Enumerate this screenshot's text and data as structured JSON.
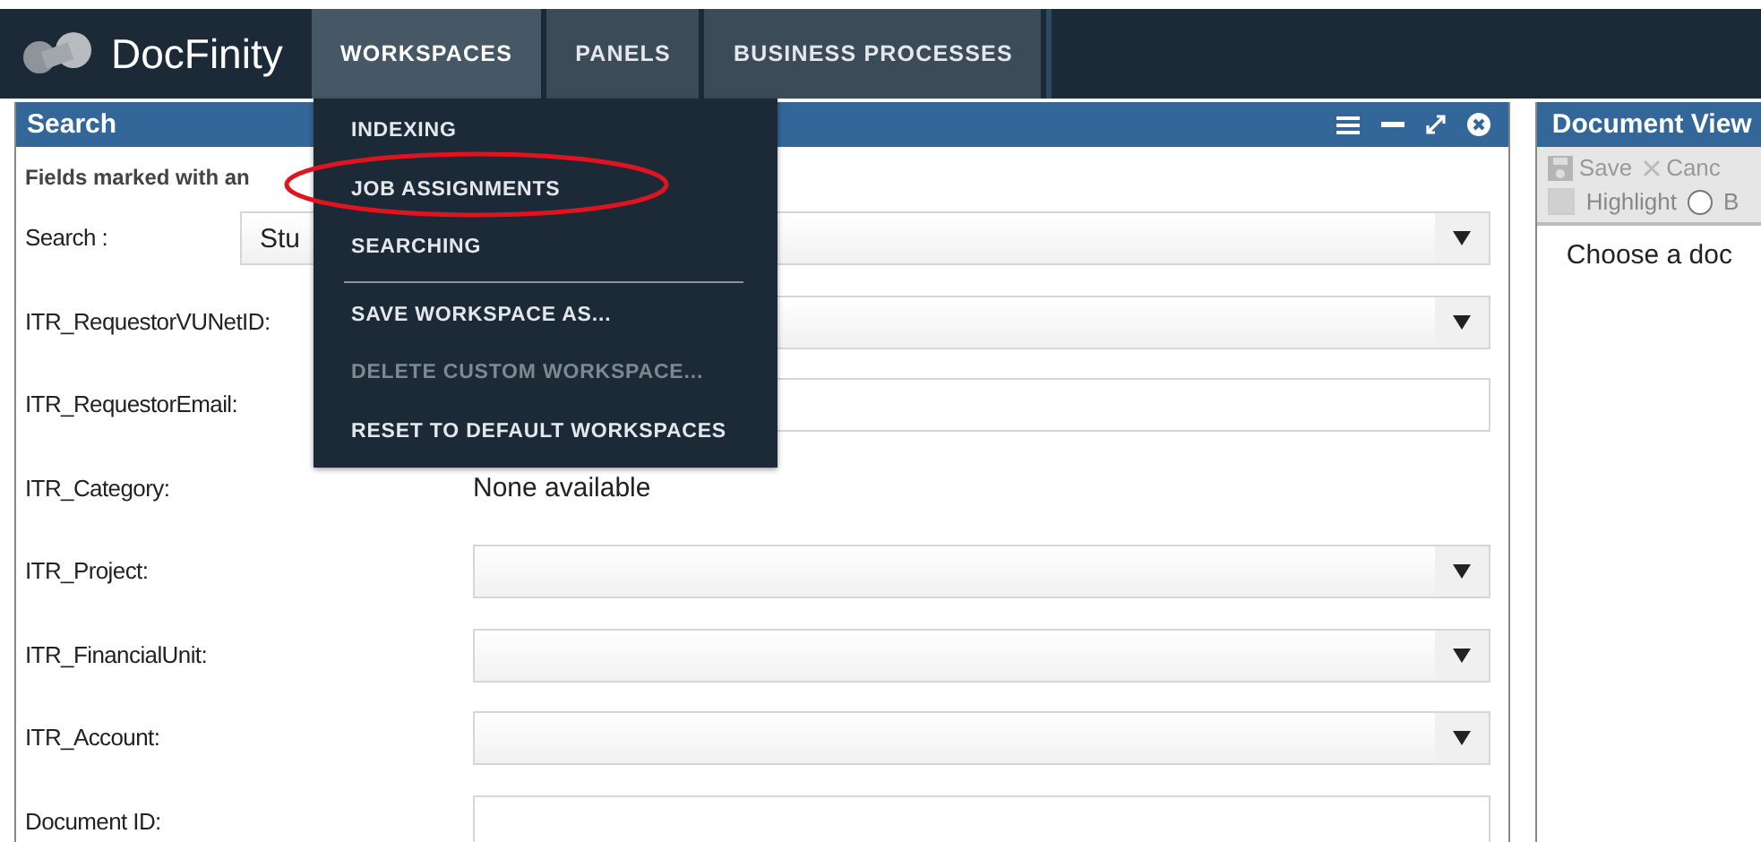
{
  "app": {
    "name": "DocFinity"
  },
  "nav": [
    {
      "label": "WORKSPACES",
      "selected": true
    },
    {
      "label": "PANELS",
      "selected": false
    },
    {
      "label": "BUSINESS PROCESSES",
      "selected": false
    }
  ],
  "menu": {
    "groups": [
      [
        {
          "label": "INDEXING",
          "disabled": false,
          "highlighted": false
        },
        {
          "label": "JOB ASSIGNMENTS",
          "disabled": false,
          "highlighted": true
        },
        {
          "label": "SEARCHING",
          "disabled": false,
          "highlighted": false
        }
      ],
      [
        {
          "label": "SAVE WORKSPACE AS...",
          "disabled": false,
          "highlighted": false
        },
        {
          "label": "DELETE CUSTOM WORKSPACE...",
          "disabled": true,
          "highlighted": false
        },
        {
          "label": "RESET TO DEFAULT WORKSPACES",
          "disabled": false,
          "highlighted": false
        }
      ]
    ]
  },
  "search_panel": {
    "title": "Search",
    "note": "Fields marked with an",
    "fields": [
      {
        "label": "Search :",
        "kind": "select",
        "value": "Stu"
      },
      {
        "label": "ITR_RequestorVUNetID:",
        "kind": "select"
      },
      {
        "label": "ITR_RequestorEmail:",
        "kind": "text"
      },
      {
        "label": "ITR_Category:",
        "kind": "static",
        "value": "None available"
      },
      {
        "label": "ITR_Project:",
        "kind": "select"
      },
      {
        "label": "ITR_FinancialUnit:",
        "kind": "select"
      },
      {
        "label": "ITR_Account:",
        "kind": "select"
      },
      {
        "label": "Document ID:",
        "kind": "text"
      }
    ]
  },
  "viewer": {
    "title": "Document View",
    "save": {
      "label": "Save",
      "disabled": true
    },
    "cancel": {
      "label": "Canc",
      "disabled": true
    },
    "highlight": {
      "label": "Highlight",
      "checked": false
    },
    "option": {
      "label": "B",
      "selected": false
    },
    "message": "Choose a doc"
  }
}
